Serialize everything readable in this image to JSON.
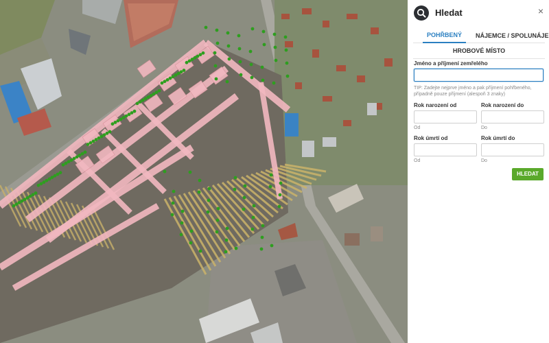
{
  "panel": {
    "title": "Hledat",
    "close_glyph": "×",
    "search_icon": "search-icon",
    "tabs": [
      {
        "label": "POHŘBENÝ",
        "active": true
      },
      {
        "label": "NÁJEMCE / SPOLUNÁJEMCE",
        "active": false
      },
      {
        "label": "HROBOVÉ MÍSTO",
        "active": false
      }
    ]
  },
  "form": {
    "name_label": "Jméno a příjmení zemřelého",
    "name_value": "",
    "tip": "TIP: Zadejte nejprve jméno a pak příjmení pohřbeného, případně pouze příjmení (alespoň 3 znaky)",
    "birth_from_label": "Rok narození od",
    "birth_to_label": "Rok narození do",
    "birth_from_sub": "Od",
    "birth_to_sub": "Do",
    "death_from_label": "Rok úmrtí od",
    "death_to_label": "Rok úmrtí do",
    "death_from_sub": "Od",
    "death_to_sub": "Do",
    "submit_label": "HLEDAT"
  },
  "colors": {
    "accent": "#2a7fc1",
    "submit": "#5aa92b",
    "grave_highlight": "#f2b8c0",
    "tree_marker": "#2e9e1f"
  }
}
